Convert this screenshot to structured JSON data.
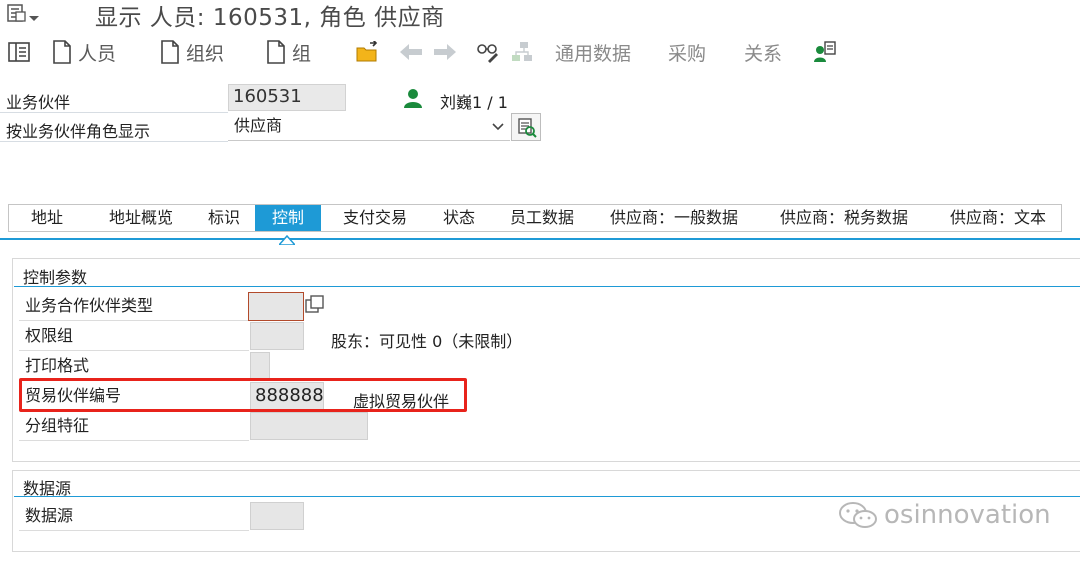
{
  "title": {
    "text": "显示 人员: 160531, 角色 供应商"
  },
  "toolbar": {
    "person_label": "人员",
    "org_label": "组织",
    "group_label": "组",
    "general_data_label": "通用数据",
    "purchasing_label": "采购",
    "relations_label": "关系"
  },
  "header": {
    "bp_label": "业务伙伴",
    "bp_value": "160531",
    "person_name": "刘巍1 / 1",
    "role_label": "按业务伙伴角色显示",
    "role_value": "供应商"
  },
  "tabs": [
    {
      "label": "地址"
    },
    {
      "label": "地址概览"
    },
    {
      "label": "标识"
    },
    {
      "label": "控制"
    },
    {
      "label": "支付交易"
    },
    {
      "label": "状态"
    },
    {
      "label": "员工数据"
    },
    {
      "label": "供应商：一般数据"
    },
    {
      "label": "供应商：税务数据"
    },
    {
      "label": "供应商：文本"
    }
  ],
  "control_params": {
    "title": "控制参数",
    "bp_type_label": "业务合作伙伴类型",
    "auth_group_label": "权限组",
    "shareholder_text": "股东：可见性 0（未限制）",
    "print_format_label": "打印格式",
    "trading_partner_label": "贸易伙伴编号",
    "trading_partner_value": "888888",
    "trading_partner_desc": "虚拟贸易伙伴",
    "grouping_label": "分组特征"
  },
  "data_source": {
    "title": "数据源",
    "label": "数据源"
  },
  "watermark": "osinnovation",
  "colors": {
    "accent": "#1e9ad6",
    "highlight": "#e8231b",
    "person_icon": "#1a8a3c"
  }
}
